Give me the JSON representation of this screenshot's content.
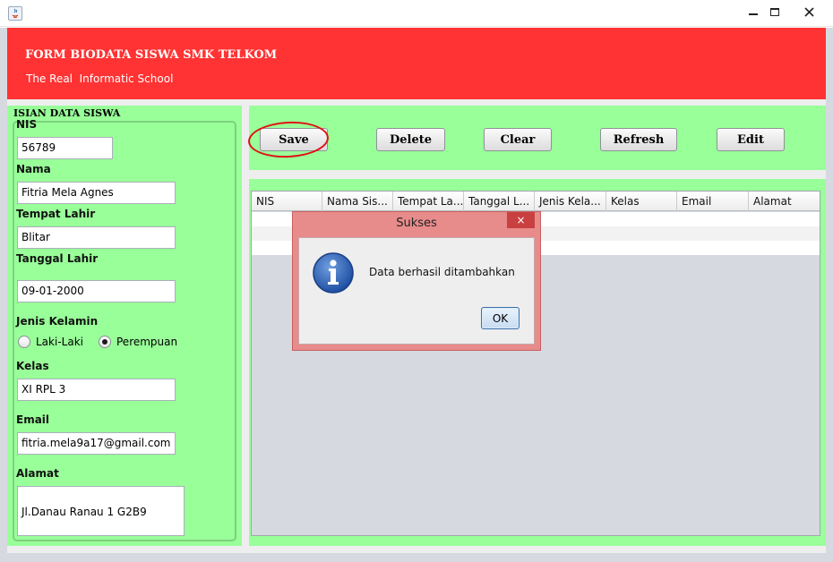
{
  "window": {
    "icon": "java-icon"
  },
  "header": {
    "title": "FORM BIODATA SISWA SMK TELKOM",
    "subtitle": "The Real  Informatic School"
  },
  "form": {
    "section_title": "ISIAN DATA SISWA",
    "nis_label": "NIS",
    "nis_value": "56789",
    "nama_label": "Nama",
    "nama_value": "Fitria Mela Agnes",
    "tempat_label": "Tempat Lahir",
    "tempat_value": "Blitar",
    "tanggal_label": "Tanggal Lahir",
    "tanggal_value": "09-01-2000",
    "jk_label": "Jenis Kelamin",
    "jk_options": [
      "Laki-Laki",
      "Perempuan"
    ],
    "jk_selected": "Perempuan",
    "kelas_label": "Kelas",
    "kelas_value": "XI RPL 3",
    "email_label": "Email",
    "email_value": "fitria.mela9a17@gmail.com",
    "alamat_label": "Alamat",
    "alamat_value": "Jl.Danau Ranau 1 G2B9"
  },
  "toolbar": {
    "save": "Save",
    "delete": "Delete",
    "clear": "Clear",
    "refresh": "Refresh",
    "edit": "Edit"
  },
  "table": {
    "columns": [
      "NIS",
      "Nama Sis...",
      "Tempat La...",
      "Tanggal L...",
      "Jenis Kela...",
      "Kelas",
      "Email",
      "Alamat"
    ]
  },
  "dialog": {
    "title": "Sukses",
    "close": "×",
    "message": "Data berhasil ditambahkan",
    "ok": "OK",
    "icon": "info-icon"
  },
  "colors": {
    "header_bg": "#ff3333",
    "panel_bg": "#99ff99",
    "dialog_frame": "#e88b8b",
    "annotation_ring": "#e01010"
  }
}
